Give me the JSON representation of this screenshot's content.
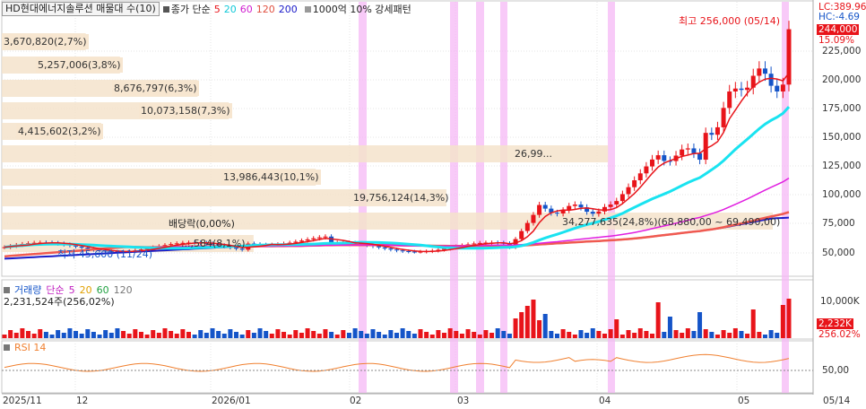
{
  "header": {
    "stock_name": "HD현대에너지솔루션 매물대 수(10)",
    "ma_title": "종가 단순",
    "ma_periods": [
      "5",
      "20",
      "60",
      "120",
      "200"
    ],
    "volume_profile": "1000억 10% 강세패턴"
  },
  "colors": {
    "up": "#e8141a",
    "down": "#1454c8",
    "ma5": "#e8141a",
    "ma20": "#19e3f0",
    "ma60": "#e01ee0",
    "ma120": "#f05a50",
    "ma200": "#1a1ac8",
    "volume_profile_bar": "#f5e3cb",
    "highlight": "#f5b8f5",
    "rsi": "#f08030"
  },
  "price_axis": {
    "ticks": [
      "225,000",
      "200,000",
      "175,000",
      "150,000",
      "125,000",
      "100,000",
      "75,000",
      "50,000"
    ],
    "lc": "LC:389.96",
    "hc": "HC:-4.69",
    "current_price": "244,000",
    "change_pct": "15.09%"
  },
  "volume_profile_labels": [
    "3,670,820(2,7%)",
    "5,257,006(3,8%)",
    "8,676,797(6,3%)",
    "10,073,158(7,3%)",
    "4,415,602(3,2%)",
    "26,99...",
    "13,986,443(10,1%)",
    "19,756,124(14,3%)",
    "34,277,635(24,8%)(68,880,00 ~ 69,490,00)",
    "...,584(8,1%)"
  ],
  "volume_profile_values": [
    2.7,
    3.8,
    6.3,
    7.3,
    3.2,
    19.5,
    10.1,
    14.3,
    24.8,
    8.1
  ],
  "annotations": {
    "high": "최고 256,000 (05/14)",
    "dividend": "배당락(0,00%)",
    "low": "최저 45,600 (11/24)"
  },
  "volume_pane": {
    "title": "거래량",
    "ma_title": "단순",
    "ma_periods": [
      "5",
      "20",
      "60",
      "120"
    ],
    "value": "2,231,524주(256,02%)",
    "axis_tick": "10,000K",
    "current_tag": "2,232K",
    "current_pct": "256.02%"
  },
  "rsi_pane": {
    "title": "RSI 14",
    "axis_tick": "50,00"
  },
  "x_axis": {
    "ticks": [
      "2025/11",
      "12",
      "2026/01",
      "02",
      "03",
      "04",
      "05",
      "05/14"
    ]
  }
}
